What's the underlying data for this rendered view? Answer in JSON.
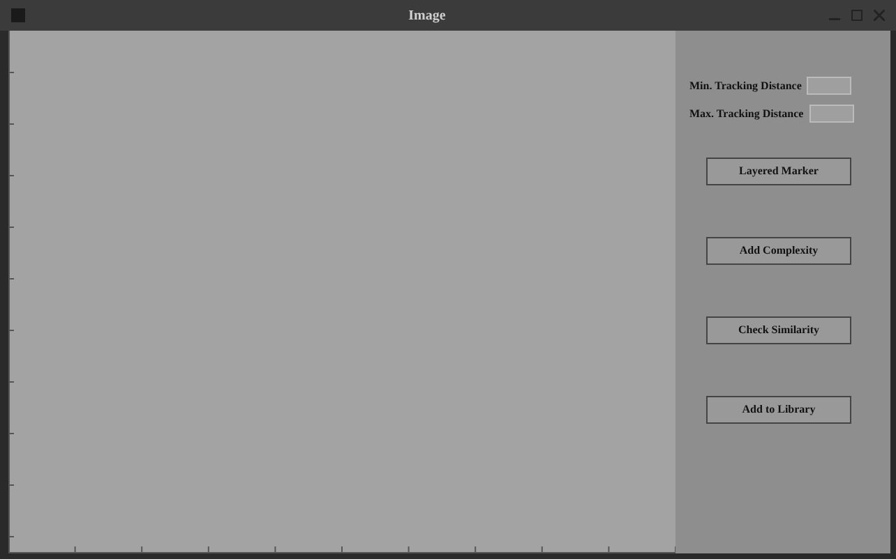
{
  "window": {
    "title": "Image"
  },
  "fields": [
    {
      "label": "Min. Tracking Distance"
    },
    {
      "label": "Max. Tracking Distance"
    }
  ],
  "buttons": [
    "Layered Marker",
    "Add Complexity",
    "Check Similarity",
    "Add to Library"
  ]
}
